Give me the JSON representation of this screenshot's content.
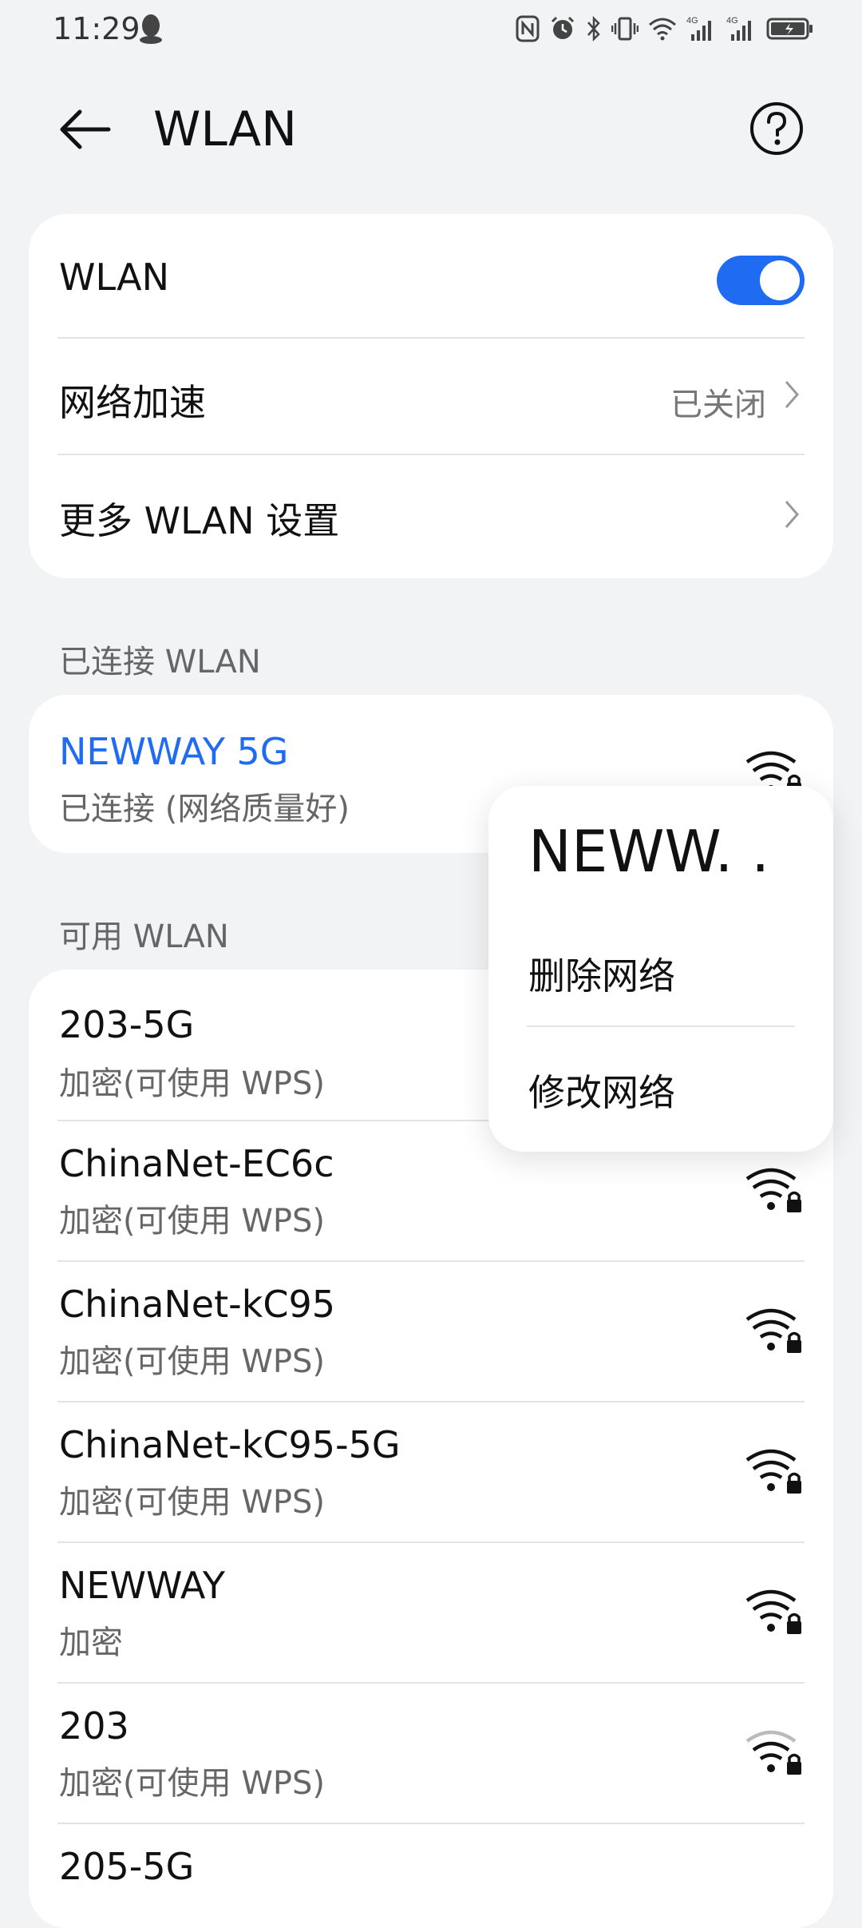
{
  "status_bar": {
    "time": "11:29",
    "icons": [
      "nfc-icon",
      "alarm-icon",
      "bluetooth-icon",
      "vibrate-icon",
      "wifi-status-icon",
      "signal-4g-icon",
      "signal-4g-icon-2",
      "battery-charging-icon"
    ],
    "signal_label_1": "4G",
    "signal_label_2": "4G"
  },
  "header": {
    "title": "WLAN",
    "back_icon": "arrow-left-icon",
    "help_icon": "help-circle-icon"
  },
  "settings_card": {
    "wlan_label": "WLAN",
    "wlan_toggle_on": true,
    "accel_label": "网络加速",
    "accel_value": "已关闭",
    "more_label": "更多 WLAN 设置"
  },
  "connected_section": {
    "label": "已连接 WLAN",
    "network": {
      "name": "NEWWAY 5G",
      "status": "已连接 (网络质量好)"
    }
  },
  "available_section": {
    "label": "可用 WLAN",
    "networks": [
      {
        "name": "203-5G",
        "security": "加密(可使用 WPS)"
      },
      {
        "name": "ChinaNet-EC6c",
        "security": "加密(可使用 WPS)"
      },
      {
        "name": "ChinaNet-kC95",
        "security": "加密(可使用 WPS)"
      },
      {
        "name": "ChinaNet-kC95-5G",
        "security": "加密(可使用 WPS)"
      },
      {
        "name": "NEWWAY",
        "security": "加密"
      },
      {
        "name": "203",
        "security": "加密(可使用 WPS)"
      },
      {
        "name": "205-5G",
        "security": ""
      }
    ]
  },
  "popup": {
    "title": "NEWW. .",
    "items": [
      "删除网络",
      "修改网络"
    ]
  },
  "colors": {
    "accent": "#1f6cf2",
    "background": "#f1f3f5"
  }
}
